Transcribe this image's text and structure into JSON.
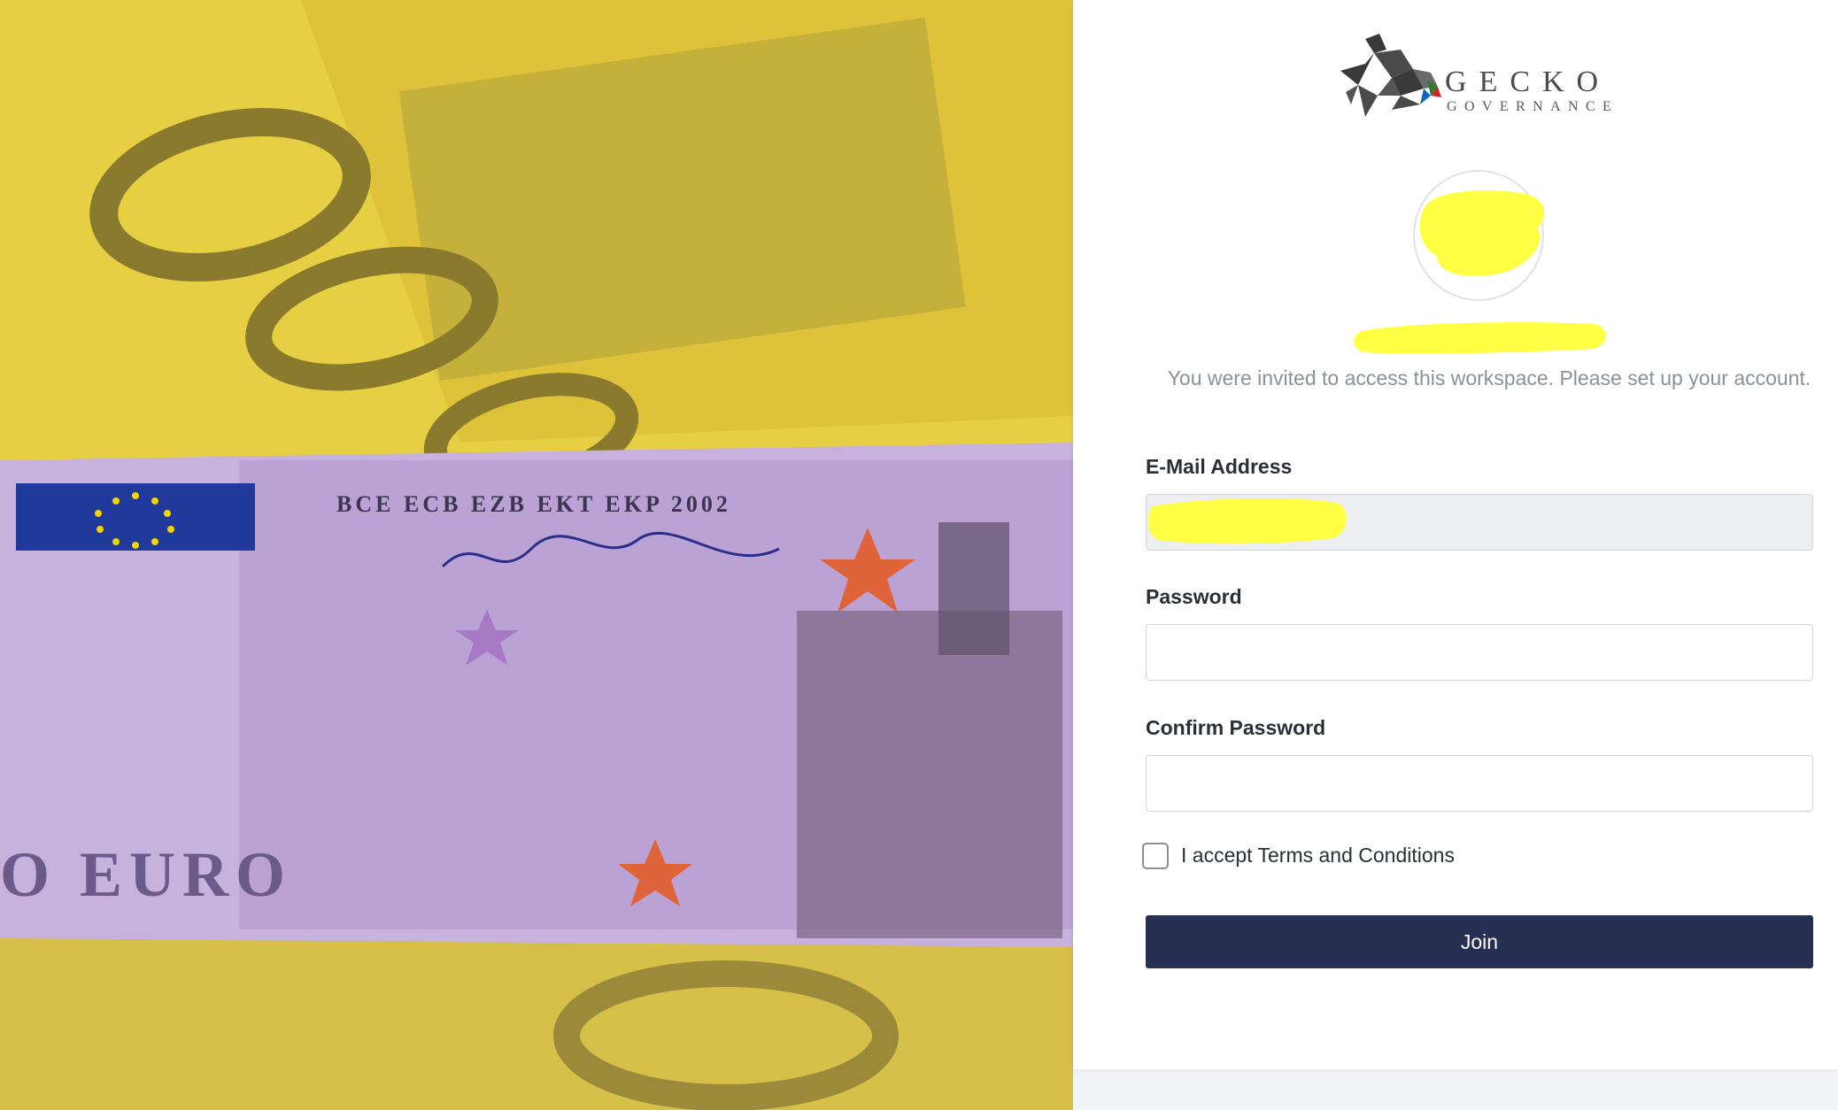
{
  "brand": {
    "name": "GECKO",
    "tagline": "GOVERNANCE",
    "logo_icon": "gecko-logo-icon"
  },
  "invite_message": "You were invited to access this workspace. Please set up your account.",
  "form": {
    "email_label": "E-Mail Address",
    "email_value": "",
    "password_label": "Password",
    "password_value": "",
    "confirm_label": "Confirm Password",
    "confirm_value": "",
    "terms_label": "I accept Terms and Conditions",
    "terms_checked": false,
    "submit_label": "Join"
  },
  "colors": {
    "primary_button": "#272f55",
    "redaction_highlight": "#ffff44",
    "muted_text": "#8a9199"
  }
}
